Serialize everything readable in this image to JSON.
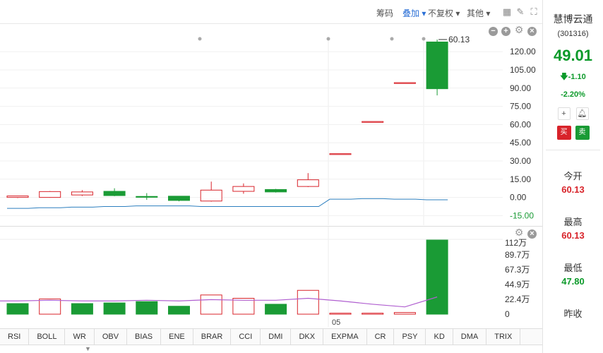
{
  "toolbar": {
    "chips": "筹码",
    "overlay": "叠加",
    "adjust": "不复权",
    "other": "其他"
  },
  "stock": {
    "name": "慧博云通",
    "code": "(301316)",
    "price": "49.01",
    "change": "-1.10",
    "change_pct": "-2.20%",
    "buy_label": "买",
    "sell_label": "卖",
    "open_label": "今开",
    "open_value": "60.13",
    "high_label": "最高",
    "high_value": "60.13",
    "low_label": "最低",
    "low_value": "47.80",
    "prev_close_label": "昨收"
  },
  "colors": {
    "up": "#d8232a",
    "down": "#1a9b35",
    "ma_line": "#b05fd0",
    "price_green": "#0c9a2a"
  },
  "indicator_tabs": [
    "RSI",
    "BOLL",
    "WR",
    "OBV",
    "BIAS",
    "ENE",
    "BRAR",
    "CCI",
    "DMI",
    "DKX",
    "EXPMA",
    "CR",
    "PSY",
    "KD",
    "DMA",
    "TRIX"
  ],
  "chart_data": [
    {
      "type": "candlestick",
      "title": "",
      "x_tick_label": "05",
      "max_marker": "60.13",
      "y_ticks": [
        "120.00",
        "105.00",
        "90.00",
        "75.00",
        "60.00",
        "45.00",
        "30.00",
        "15.00",
        "0.00",
        "-15.00"
      ],
      "ylim": [
        -20,
        130
      ],
      "candles": [
        {
          "open": 0.0,
          "close": 1.2,
          "high": 1.4,
          "low": -0.5,
          "up": true
        },
        {
          "open": 0.0,
          "close": 4.8,
          "high": 5.2,
          "low": -0.3,
          "up": true
        },
        {
          "open": 2.0,
          "close": 4.5,
          "high": 6.0,
          "low": 1.2,
          "up": true
        },
        {
          "open": 5.0,
          "close": 1.5,
          "high": 7.5,
          "low": 1.0,
          "up": false
        },
        {
          "open": 0.8,
          "close": 0.3,
          "high": 3.5,
          "low": -2.0,
          "up": false
        },
        {
          "open": 1.0,
          "close": -2.5,
          "high": 1.2,
          "low": -3.2,
          "up": false
        },
        {
          "open": -3.0,
          "close": 6.0,
          "high": 13.0,
          "low": -3.5,
          "up": true
        },
        {
          "open": 5.0,
          "close": 9.0,
          "high": 11.5,
          "low": 3.0,
          "up": true
        },
        {
          "open": 6.5,
          "close": 4.5,
          "high": 7.0,
          "low": 4.0,
          "up": false
        },
        {
          "open": 9.0,
          "close": 14.5,
          "high": 20.0,
          "low": 8.5,
          "up": true
        },
        {
          "open": 36.0,
          "close": 36.0,
          "high": 36.0,
          "low": 36.0,
          "up": true
        },
        {
          "open": 62.5,
          "close": 62.5,
          "high": 62.5,
          "low": 62.5,
          "up": true
        },
        {
          "open": 94.5,
          "close": 94.5,
          "high": 94.5,
          "low": 94.5,
          "up": true
        },
        {
          "open": 128.0,
          "close": 89.5,
          "high": 130.0,
          "low": 84.0,
          "up": false
        }
      ],
      "ma_line": [
        -9.0,
        -8.5,
        -8.0,
        -7.5,
        -7.0,
        -7.0,
        -7.5,
        -7.5,
        -7.5,
        -7.5,
        -1.5,
        -1.0,
        -1.5,
        -2.0
      ]
    },
    {
      "type": "bar",
      "title": "volume",
      "y_ticks": [
        "112万",
        "89.7万",
        "67.3万",
        "44.9万",
        "22.4万",
        "0"
      ],
      "ylim": [
        0,
        112
      ],
      "values": [
        16,
        23,
        16,
        17,
        19,
        12,
        29,
        24,
        15,
        36,
        1.5,
        1.5,
        2.5,
        112
      ],
      "up": [
        false,
        true,
        false,
        false,
        false,
        false,
        true,
        true,
        false,
        true,
        true,
        true,
        true,
        false
      ],
      "ma_values": [
        20,
        21,
        20,
        20,
        21,
        20,
        22,
        21,
        21,
        24,
        20,
        15,
        11,
        26
      ]
    }
  ]
}
